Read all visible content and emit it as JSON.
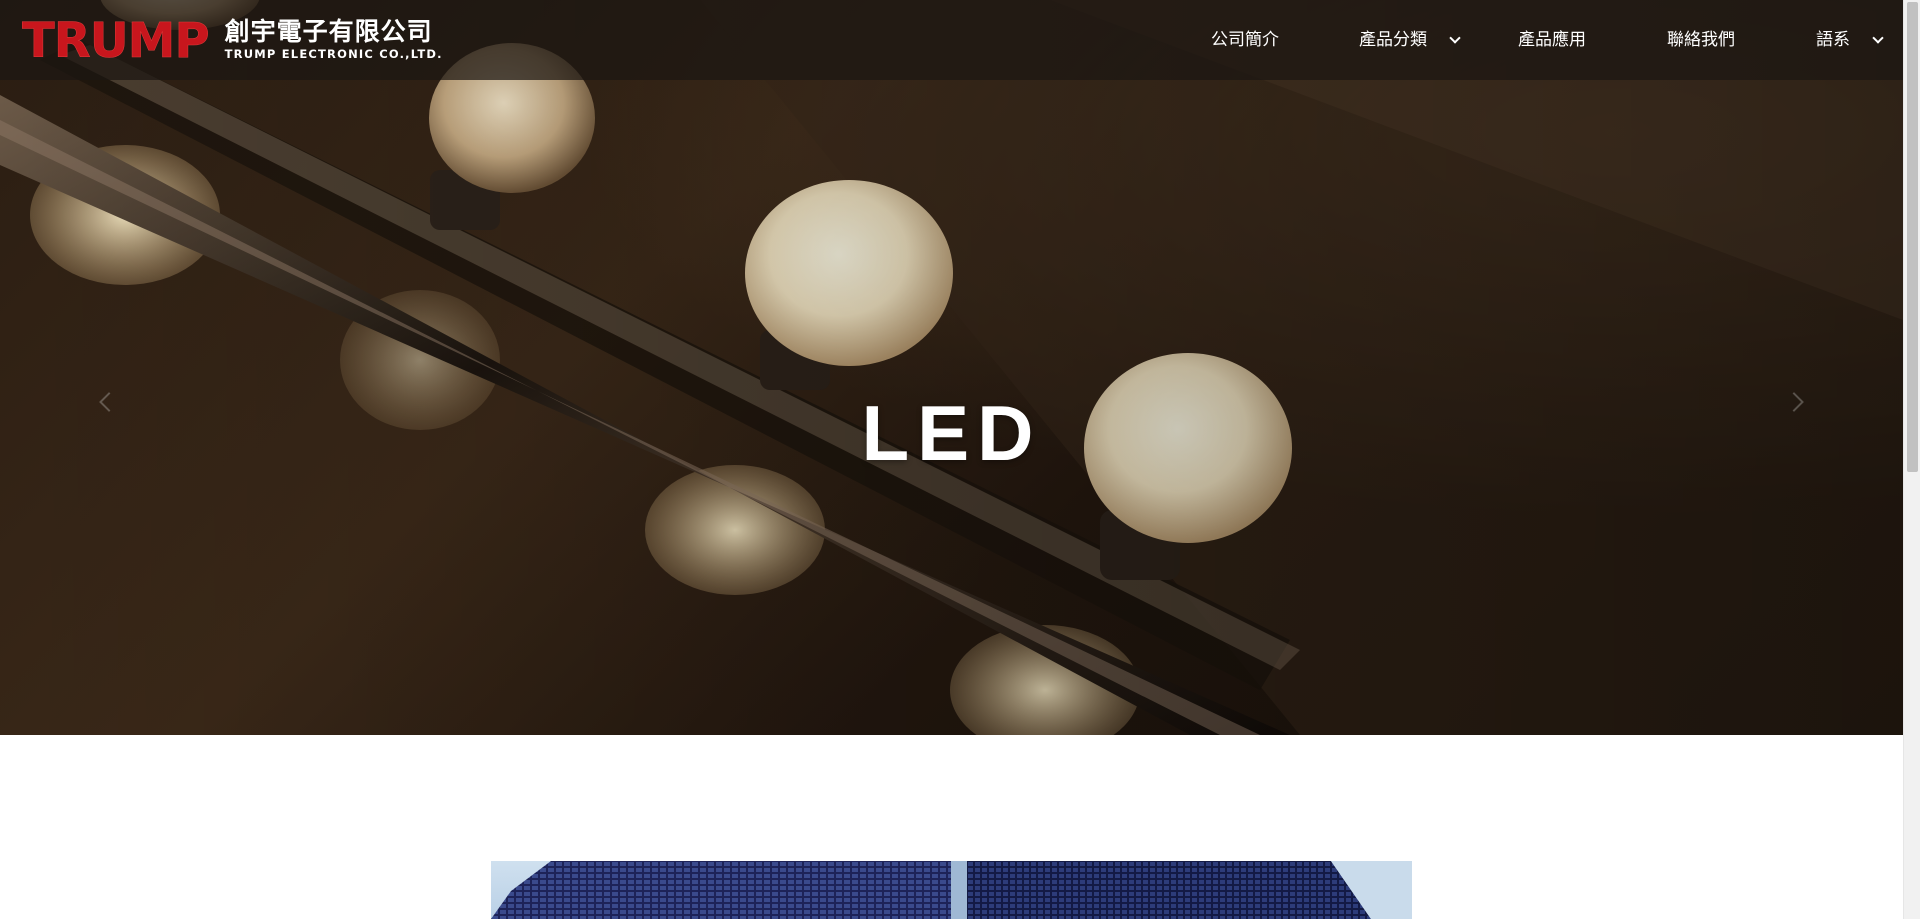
{
  "brand": {
    "mark": "TRUMP",
    "name_cn": "創宇電子有限公司",
    "name_en": "TRUMP ELECTRONIC CO.,LTD."
  },
  "nav": {
    "items": [
      {
        "label": "公司簡介",
        "has_dropdown": false
      },
      {
        "label": "產品分類",
        "has_dropdown": true
      },
      {
        "label": "產品應用",
        "has_dropdown": false
      },
      {
        "label": "聯絡我們",
        "has_dropdown": false
      },
      {
        "label": "語系",
        "has_dropdown": true
      }
    ]
  },
  "hero": {
    "title": "LED"
  },
  "colors": {
    "brand_red": "#c8161d",
    "nav_text": "#ffffff"
  },
  "icons": [
    "chevron-down-icon",
    "chevron-left-icon",
    "chevron-right-icon"
  ]
}
